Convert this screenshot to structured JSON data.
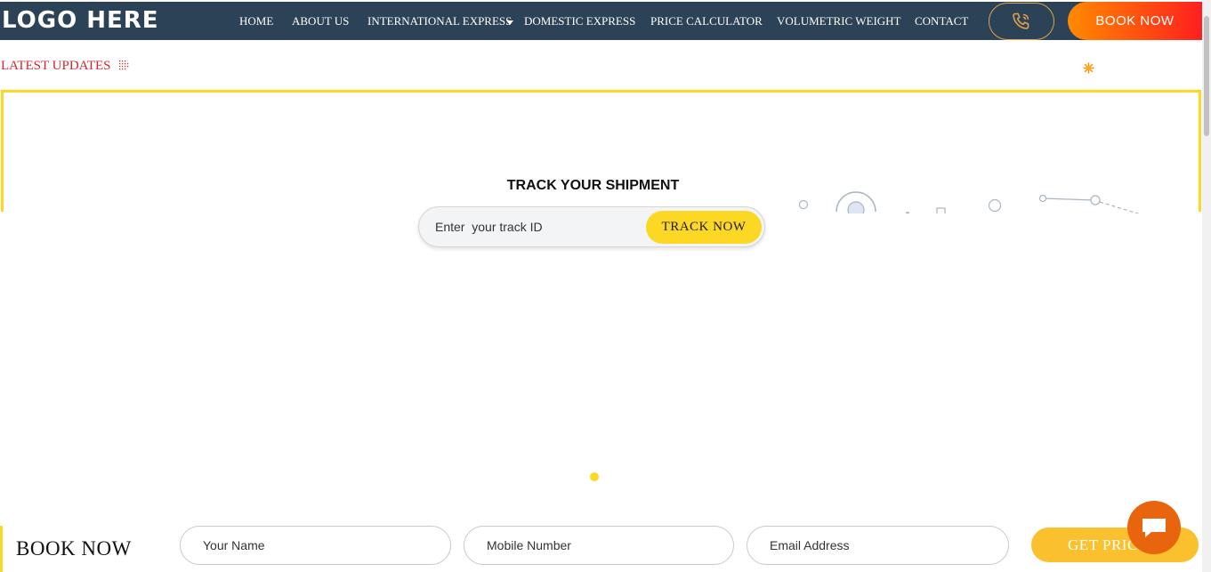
{
  "brand": {
    "logo": "LOGO HERE"
  },
  "nav": {
    "items": [
      {
        "label": "HOME"
      },
      {
        "label": "ABOUT US"
      },
      {
        "label": "INTERNATIONAL EXPRESS"
      },
      {
        "label": "DOMESTIC EXPRESS"
      },
      {
        "label": "PRICE CALCULATOR"
      },
      {
        "label": "VOLUMETRIC WEIGHT"
      },
      {
        "label": "CONTACT"
      }
    ],
    "book_label": "BOOK NOW",
    "phone_icon": "phone-icon"
  },
  "updates": {
    "label": "LATEST UPDATES"
  },
  "track": {
    "title": "TRACK YOUR SHIPMENT",
    "placeholder": "Enter  your track ID",
    "button": "TRACK NOW"
  },
  "booking": {
    "title": "BOOK NOW",
    "name_placeholder": "Your Name",
    "mobile_placeholder": "Mobile Number",
    "email_placeholder": "Email Address",
    "submit": "GET PRICE"
  },
  "colors": {
    "nav_bg": "#2b4257",
    "accent_yellow": "#fcd723",
    "accent_red": "#d4262d",
    "chat_orange": "#e8650d"
  }
}
